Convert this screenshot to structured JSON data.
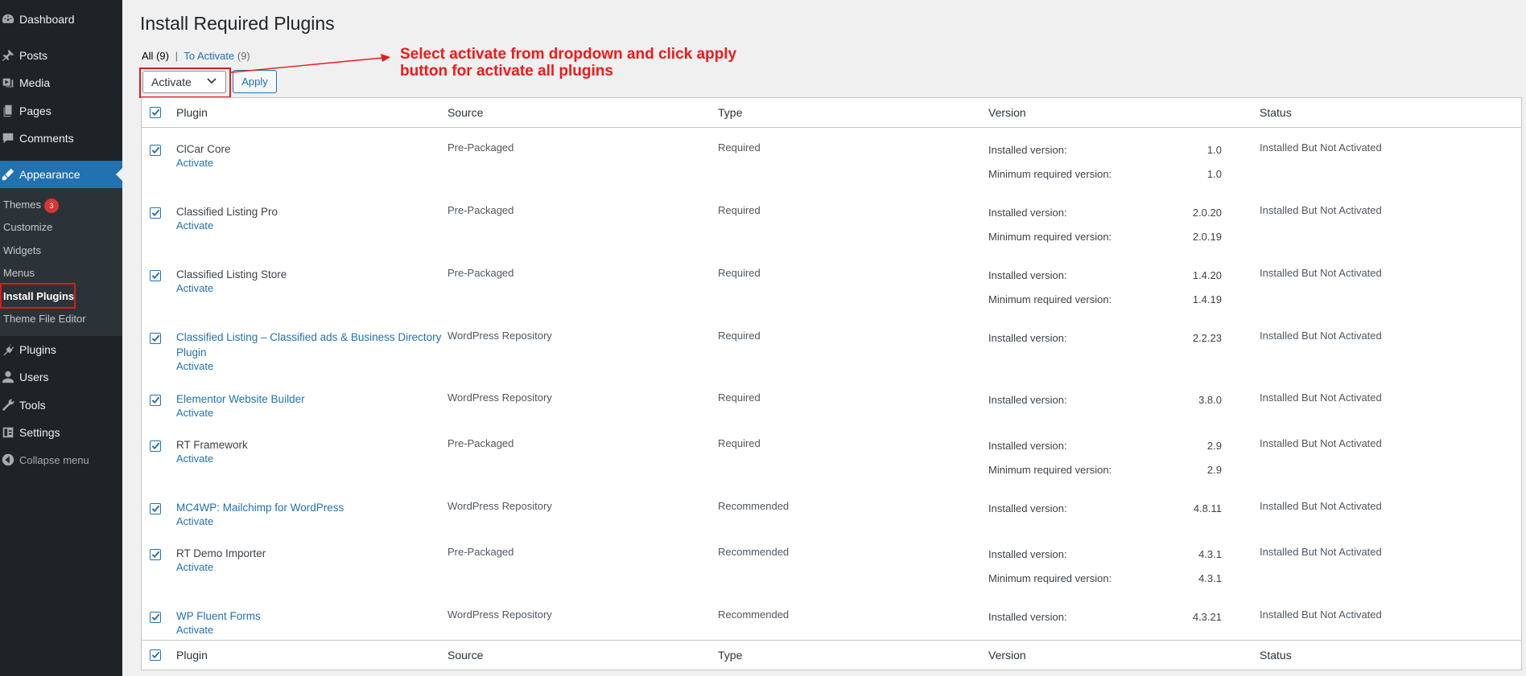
{
  "sidebar": {
    "items": [
      {
        "label": "Dashboard",
        "icon": "dashboard-icon"
      },
      {
        "label": "Posts",
        "icon": "pin-icon"
      },
      {
        "label": "Media",
        "icon": "media-icon"
      },
      {
        "label": "Pages",
        "icon": "pages-icon"
      },
      {
        "label": "Comments",
        "icon": "comments-icon"
      },
      {
        "label": "Appearance",
        "icon": "appearance-icon"
      },
      {
        "label": "Plugins",
        "icon": "plugins-icon"
      },
      {
        "label": "Users",
        "icon": "users-icon"
      },
      {
        "label": "Tools",
        "icon": "tools-icon"
      },
      {
        "label": "Settings",
        "icon": "settings-icon"
      },
      {
        "label": "Collapse menu",
        "icon": "collapse-icon"
      }
    ],
    "submenu": [
      {
        "label": "Themes",
        "badge": "3"
      },
      {
        "label": "Customize"
      },
      {
        "label": "Widgets"
      },
      {
        "label": "Menus"
      },
      {
        "label": "Install Plugins"
      },
      {
        "label": "Theme File Editor"
      }
    ]
  },
  "page": {
    "title": "Install Required Plugins",
    "filters": {
      "all_label": "All",
      "all_count": "(9)",
      "separator": "|",
      "to_activate_label": "To Activate",
      "to_activate_count": "(9)"
    },
    "bulk_action": "Activate",
    "apply_label": "Apply",
    "annotation_line1": "Select activate from dropdown and click apply",
    "annotation_line2": "button for activate all plugins"
  },
  "table": {
    "columns": [
      "Plugin",
      "Source",
      "Type",
      "Version",
      "Status"
    ],
    "installed_label": "Installed version:",
    "minimum_label": "Minimum required version:",
    "activate_label": "Activate",
    "rows": [
      {
        "name": "ClCar Core",
        "link": false,
        "source": "Pre-Packaged",
        "type": "Required",
        "installed": "1.0",
        "minimum": "1.0",
        "status": "Installed But Not Activated"
      },
      {
        "name": "Classified Listing Pro",
        "link": false,
        "source": "Pre-Packaged",
        "type": "Required",
        "installed": "2.0.20",
        "minimum": "2.0.19",
        "status": "Installed But Not Activated"
      },
      {
        "name": "Classified Listing Store",
        "link": false,
        "source": "Pre-Packaged",
        "type": "Required",
        "installed": "1.4.20",
        "minimum": "1.4.19",
        "status": "Installed But Not Activated"
      },
      {
        "name": "Classified Listing – Classified ads & Business Directory",
        "name2": "Plugin",
        "link": true,
        "source": "WordPress Repository",
        "type": "Required",
        "installed": "2.2.23",
        "status": "Installed But Not Activated"
      },
      {
        "name": "Elementor Website Builder",
        "link": true,
        "source": "WordPress Repository",
        "type": "Required",
        "installed": "3.8.0",
        "status": "Installed But Not Activated"
      },
      {
        "name": "RT Framework",
        "link": false,
        "source": "Pre-Packaged",
        "type": "Required",
        "installed": "2.9",
        "minimum": "2.9",
        "status": "Installed But Not Activated"
      },
      {
        "name": "MC4WP: Mailchimp for WordPress",
        "link": true,
        "source": "WordPress Repository",
        "type": "Recommended",
        "installed": "4.8.11",
        "status": "Installed But Not Activated"
      },
      {
        "name": "RT Demo Importer",
        "link": false,
        "source": "Pre-Packaged",
        "type": "Recommended",
        "installed": "4.3.1",
        "minimum": "4.3.1",
        "status": "Installed But Not Activated"
      },
      {
        "name": "WP Fluent Forms",
        "link": true,
        "source": "WordPress Repository",
        "type": "Recommended",
        "installed": "4.3.21",
        "status": "Installed But Not Activated"
      }
    ]
  },
  "colors": {
    "sidebar_bg": "#1d2327",
    "submenu_bg": "#2c3338",
    "accent": "#2271b1",
    "annotation": "#f01919",
    "badge": "#d63638"
  }
}
